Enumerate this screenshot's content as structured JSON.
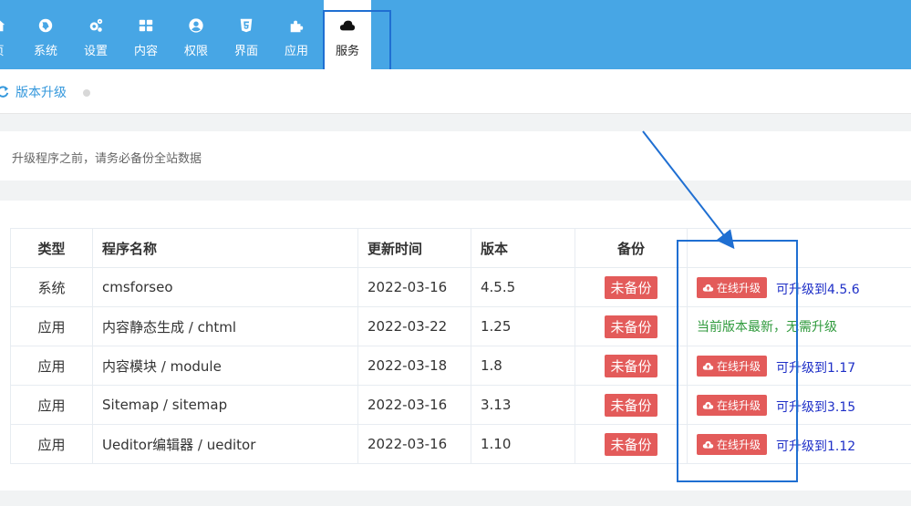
{
  "nav": {
    "items": [
      {
        "label": "页",
        "icon": "home-icon"
      },
      {
        "label": "系统",
        "icon": "globe-icon"
      },
      {
        "label": "设置",
        "icon": "gears-icon"
      },
      {
        "label": "内容",
        "icon": "grid-icon"
      },
      {
        "label": "权限",
        "icon": "user-icon"
      },
      {
        "label": "界面",
        "icon": "html5-icon"
      },
      {
        "label": "应用",
        "icon": "puzzle-icon"
      },
      {
        "label": "服务",
        "icon": "cloud-icon"
      }
    ],
    "active": "服务"
  },
  "breadcrumb": {
    "label": "版本升级"
  },
  "notice": {
    "text": "升级程序之前，请务必备份全站数据"
  },
  "table": {
    "headers": [
      "类型",
      "程序名称",
      "更新时间",
      "版本",
      "备份",
      ""
    ],
    "rows": [
      {
        "type": "系统",
        "name": "cmsforseo",
        "time": "2022-03-16",
        "version": "4.5.5",
        "backup": "未备份",
        "action": "在线升级",
        "upgrade": "可升级到4.5.6"
      },
      {
        "type": "应用",
        "name": "内容静态生成 / chtml",
        "time": "2022-03-22",
        "version": "1.25",
        "backup": "未备份",
        "status": "当前版本最新，无需升级"
      },
      {
        "type": "应用",
        "name": "内容模块 / module",
        "time": "2022-03-18",
        "version": "1.8",
        "backup": "未备份",
        "action": "在线升级",
        "upgrade": "可升级到1.17"
      },
      {
        "type": "应用",
        "name": "Sitemap / sitemap",
        "time": "2022-03-16",
        "version": "3.13",
        "backup": "未备份",
        "action": "在线升级",
        "upgrade": "可升级到3.15"
      },
      {
        "type": "应用",
        "name": "Ueditor编辑器 / ueditor",
        "time": "2022-03-16",
        "version": "1.10",
        "backup": "未备份",
        "action": "在线升级",
        "upgrade": "可升级到1.12"
      }
    ]
  },
  "colors": {
    "nav": "#47a6e5",
    "badge": "#e35b5a",
    "link": "#1e2fc7",
    "ok": "#2f9a3c",
    "highlight": "#1f6fd2"
  }
}
